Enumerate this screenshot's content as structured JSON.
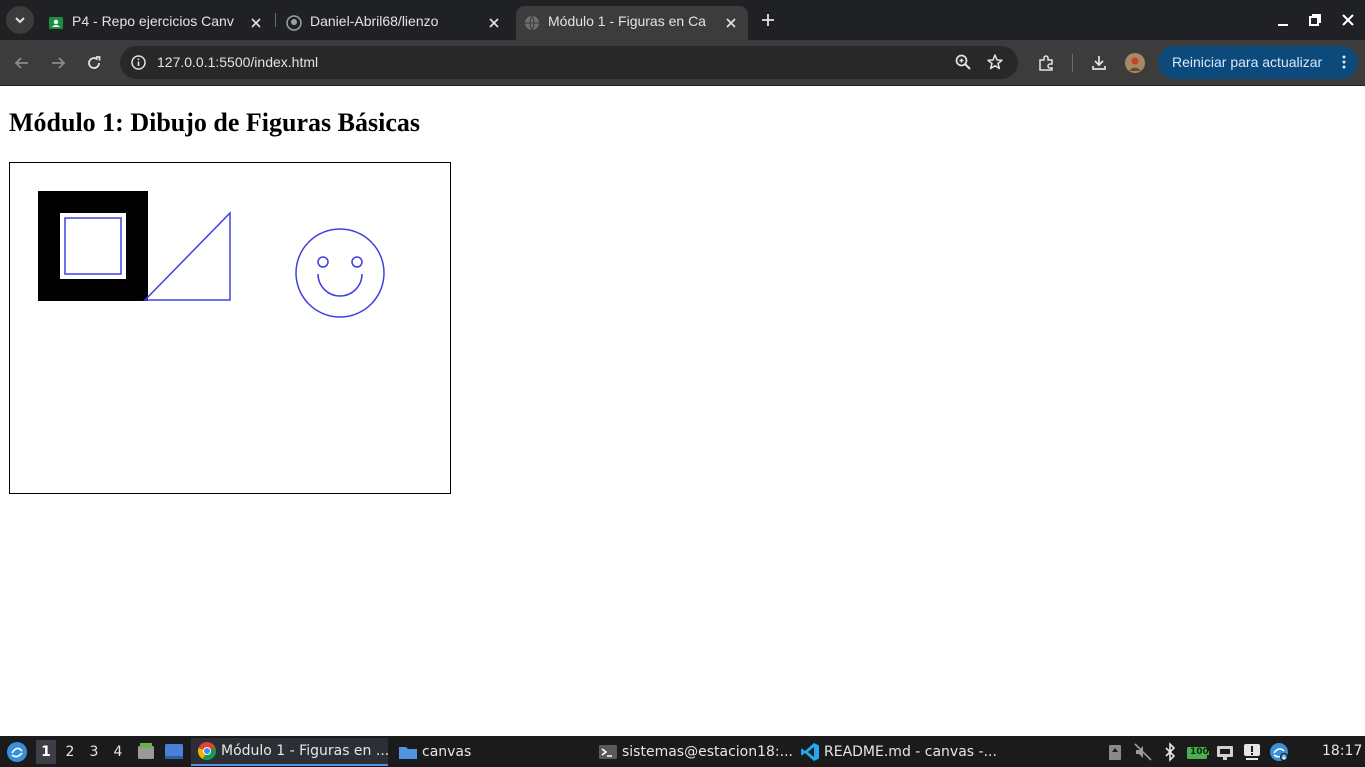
{
  "browser": {
    "tabs": [
      {
        "title": "P4 - Repo ejercicios Canv",
        "icon": "classroom-icon",
        "active": false
      },
      {
        "title": "Daniel-Abril68/lienzo",
        "icon": "github-icon",
        "active": false
      },
      {
        "title": "Módulo 1 - Figuras en Ca",
        "icon": "globe-icon",
        "active": true
      }
    ],
    "url": "127.0.0.1:5500/index.html",
    "update_button": "Reiniciar para actualizar"
  },
  "page": {
    "heading": "Módulo 1: Dibujo de Figuras Básicas",
    "canvas": {
      "stroke_color": "#4040e0",
      "fill_color": "#000000",
      "shapes": [
        "filled-square",
        "stroked-square",
        "triangle",
        "smiley-face"
      ]
    }
  },
  "taskbar": {
    "workspaces": [
      "1",
      "2",
      "3",
      "4"
    ],
    "active_workspace": "1",
    "tasks": [
      {
        "label": "Módulo 1 - Figuras en ...",
        "icon": "chrome-icon",
        "active": true
      },
      {
        "label": "canvas",
        "icon": "folder-icon",
        "active": false
      },
      {
        "label": "sistemas@estacion18:...",
        "icon": "terminal-icon",
        "active": false
      },
      {
        "label": "README.md - canvas -...",
        "icon": "vscode-icon",
        "active": false
      }
    ],
    "battery": "100",
    "clock": "18:17"
  }
}
